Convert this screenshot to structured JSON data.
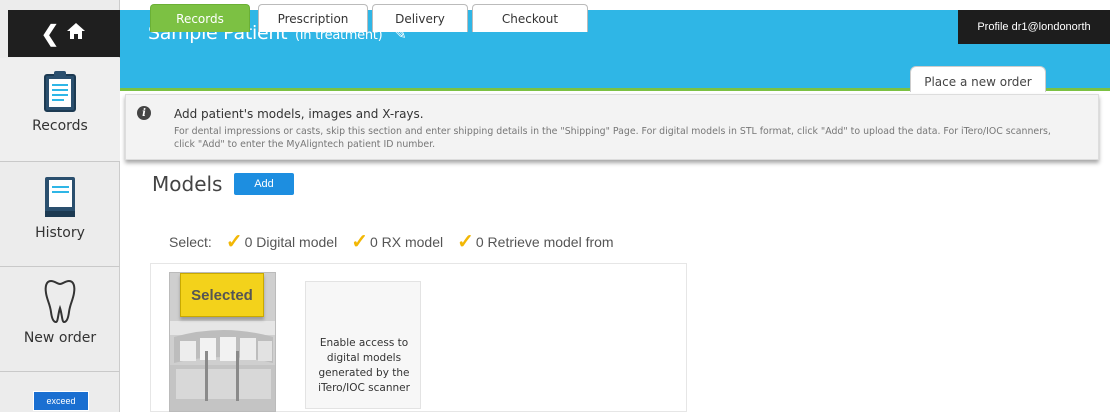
{
  "sidebar": {
    "top_icons": "‹ ⌂",
    "items": [
      {
        "label": "Records",
        "icon": "clipboard-icon"
      },
      {
        "label": "History",
        "icon": "book-icon"
      },
      {
        "label": "New order",
        "icon": "tooth-icon"
      }
    ],
    "badge": "exceed"
  },
  "header": {
    "patient_name": "Sample Patient",
    "status": "(In treatment)",
    "profile": "Profile  dr1@londonorth"
  },
  "tabs": [
    {
      "label": "Records",
      "active": true
    },
    {
      "label": "Prescription",
      "active": false
    },
    {
      "label": "Delivery",
      "active": false
    },
    {
      "label": "Checkout",
      "active": false
    }
  ],
  "place_order_tab": "Place a new order",
  "info": {
    "title": "Add patient's models, images and X-rays.",
    "text": "For dental impressions or casts, skip this section and enter shipping details in the \"Shipping\" Page. For digital models in STL format, click \"Add\" to upload the data. For iTero/IOC scanners, click \"Add\" to enter the MyAligntech patient ID number."
  },
  "models": {
    "title": "Models",
    "add_label": "Add",
    "select_label": "Select:",
    "options": [
      "0 Digital model",
      "0 RX model",
      "0 Retrieve model from"
    ],
    "selected_tag": "Selected",
    "enable_text": "Enable access to digital models generated by the iTero/IOC scanner"
  },
  "colors": {
    "header": "#2fb6e6",
    "active_tab": "#7cc143",
    "add_button": "#1d8ee0",
    "selected_tag": "#f3d21b",
    "check": "#f2b705"
  }
}
